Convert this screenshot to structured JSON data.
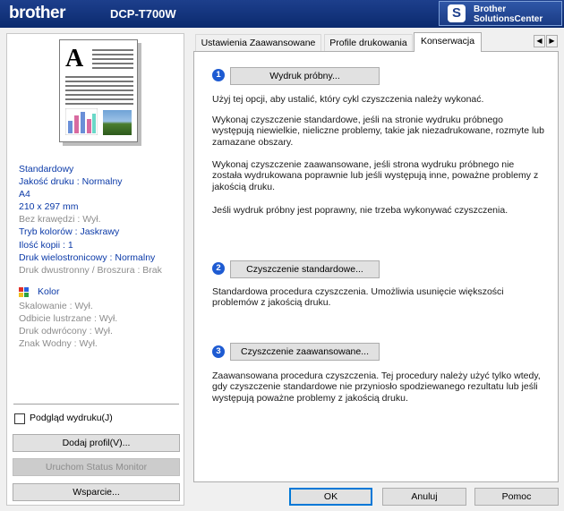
{
  "header": {
    "brand": "brother",
    "model": "DCP-T700W",
    "solutions_center": {
      "line1": "Brother",
      "line2": "SolutionsCenter"
    }
  },
  "left": {
    "settings": [
      {
        "text": "Standardowy",
        "style": "blue"
      },
      {
        "text": "Jakość druku : Normalny",
        "style": "blue"
      },
      {
        "text": "A4",
        "style": "blue"
      },
      {
        "text": "210 x 297 mm",
        "style": "blue"
      },
      {
        "text": "Bez krawędzi : Wył.",
        "style": "gray"
      },
      {
        "text": "Tryb kolorów : Jaskrawy",
        "style": "blue"
      },
      {
        "text": "Ilość kopii  : 1",
        "style": "blue"
      },
      {
        "text": "Druk wielostronicowy  : Normalny",
        "style": "blue"
      },
      {
        "text": "Druk dwustronny / Broszura : Brak",
        "style": "gray"
      }
    ],
    "color_label": "Kolor",
    "settings2": [
      "Skalowanie : Wył.",
      "Odbicie lustrzane  : Wył.",
      "Druk odwrócony  : Wył.",
      "Znak Wodny : Wył."
    ],
    "preview_checkbox": {
      "label": "Podgląd wydruku(J)",
      "checked": false
    },
    "add_profile_button": "Dodaj profil(V)...",
    "status_monitor_button": "Uruchom Status Monitor",
    "support_button": "Wsparcie..."
  },
  "tabs": [
    {
      "label": "Ustawienia Zaawansowane",
      "active": false
    },
    {
      "label": "Profile drukowania",
      "active": false
    },
    {
      "label": "Konserwacja",
      "active": true
    }
  ],
  "maintenance": {
    "step1": {
      "number": "1",
      "button": "Wydruk próbny...",
      "paragraphs": [
        "Użyj tej opcji, aby ustalić, który cykl czyszczenia należy wykonać.",
        "Wykonaj czyszczenie standardowe, jeśli na stronie wydruku próbnego występują niewielkie, nieliczne problemy, takie jak niezadrukowane, rozmyte lub zamazane obszary.",
        "Wykonaj czyszczenie zaawansowane, jeśli strona wydruku próbnego nie została wydrukowana poprawnie lub jeśli występują inne, poważne problemy z jakością druku.",
        "Jeśli wydruk próbny jest poprawny, nie trzeba wykonywać czyszczenia."
      ]
    },
    "step2": {
      "number": "2",
      "button": "Czyszczenie standardowe...",
      "text": "Standardowa procedura czyszczenia. Umożliwia usunięcie większości problemów z jakością druku."
    },
    "step3": {
      "number": "3",
      "button": "Czyszczenie zaawansowane...",
      "text": "Zaawansowana procedura czyszczenia. Tej procedury należy użyć tylko wtedy, gdy czyszczenie standardowe nie przyniosło spodziewanego rezultatu lub jeśli występują poważne problemy z jakością druku."
    }
  },
  "footer": {
    "ok": "OK",
    "cancel": "Anuluj",
    "help": "Pomoc"
  },
  "colors": {
    "header": "#0b2a6e",
    "accent": "#1e5bd2",
    "link_text": "#0b3aa8"
  }
}
